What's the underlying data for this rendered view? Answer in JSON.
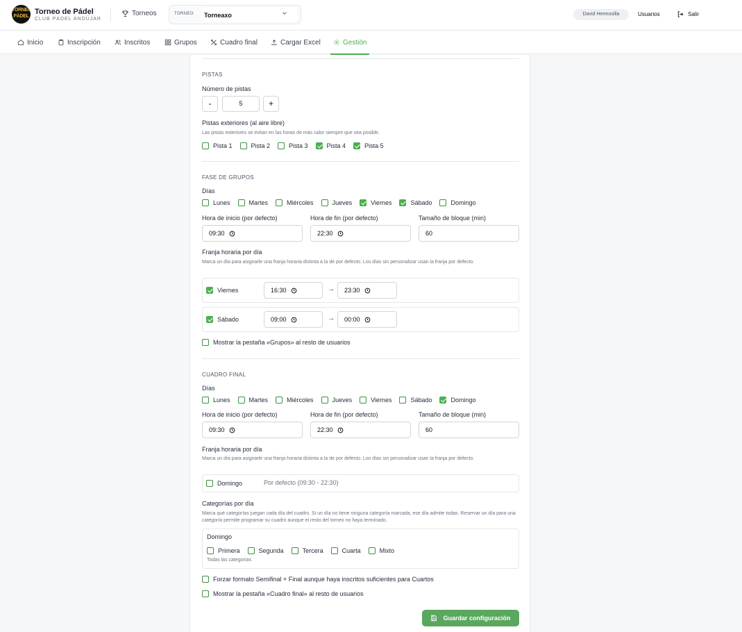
{
  "header": {
    "logo_line1": "TORNEO",
    "logo_line2": "PÁDEL",
    "title": "Torneo de Pádel",
    "subtitle": "CLUB PÁDEL ANDÚJAR",
    "torneos_label": "Torneos",
    "selector_label": "TORNEO",
    "selector_value": "Torneaxo",
    "user": "David Hermosilla",
    "usuarios": "Usuarios",
    "salir": "Salir"
  },
  "tabs": [
    {
      "label": "Inicio",
      "icon": "home-icon"
    },
    {
      "label": "Inscripción",
      "icon": "clipboard-icon"
    },
    {
      "label": "Inscritos",
      "icon": "users-icon"
    },
    {
      "label": "Grupos",
      "icon": "grid-icon"
    },
    {
      "label": "Cuadro final",
      "icon": "bracket-icon"
    },
    {
      "label": "Cargar Excel",
      "icon": "upload-icon"
    },
    {
      "label": "Gestión",
      "icon": "gear-icon",
      "active": true
    }
  ],
  "pistas": {
    "title": "PISTAS",
    "num_label": "Número de pistas",
    "minus": "-",
    "plus": "+",
    "num_value": "5",
    "ext_label": "Pistas exteriores (al aire libre)",
    "ext_help": "Las pistas exteriores se evitan en las horas de más calor siempre que sea posible.",
    "courts": [
      {
        "label": "Pista 1",
        "checked": false
      },
      {
        "label": "Pista 2",
        "checked": false
      },
      {
        "label": "Pista 3",
        "checked": false
      },
      {
        "label": "Pista 4",
        "checked": true
      },
      {
        "label": "Pista 5",
        "checked": true
      }
    ]
  },
  "grupos": {
    "title": "FASE DE GRUPOS",
    "dias_label": "Días",
    "dias": [
      {
        "label": "Lunes",
        "checked": false
      },
      {
        "label": "Martes",
        "checked": false
      },
      {
        "label": "Miércoles",
        "checked": false
      },
      {
        "label": "Jueves",
        "checked": false
      },
      {
        "label": "Viernes",
        "checked": true
      },
      {
        "label": "Sábado",
        "checked": true
      },
      {
        "label": "Domingo",
        "checked": false
      }
    ],
    "inicio_label": "Hora de inicio (por defecto)",
    "inicio": "09:30",
    "fin_label": "Hora de fin (por defecto)",
    "fin": "22:30",
    "bloque_label": "Tamaño de bloque (min)",
    "bloque": "60",
    "franja_label": "Franja horaria por día",
    "franja_help": "Marca un día para asignarle una franja horaria distinta a la de por defecto. Los días sin personalizar usan la franja por defecto.",
    "franjas": [
      {
        "day": "Viernes",
        "checked": true,
        "from": "16:30",
        "to": "23:30"
      },
      {
        "day": "Sábado",
        "checked": true,
        "from": "09:00",
        "to": "00:00"
      }
    ],
    "arrow": "→",
    "mostrar": "Mostrar la pestaña «Grupos» al resto de usuarios"
  },
  "cuadro": {
    "title": "CUADRO FINAL",
    "dias_label": "Días",
    "dias": [
      {
        "label": "Lunes",
        "checked": false
      },
      {
        "label": "Martes",
        "checked": false
      },
      {
        "label": "Miércoles",
        "checked": false
      },
      {
        "label": "Jueves",
        "checked": false
      },
      {
        "label": "Viernes",
        "checked": false
      },
      {
        "label": "Sábado",
        "checked": false
      },
      {
        "label": "Domingo",
        "checked": true
      }
    ],
    "inicio_label": "Hora de inicio (por defecto)",
    "inicio": "09:30",
    "fin_label": "Hora de fin (por defecto)",
    "fin": "22:30",
    "bloque_label": "Tamaño de bloque (min)",
    "bloque": "60",
    "franja_label": "Franja horaria por día",
    "franja_help": "Marca un día para asignarle una franja horaria distinta a la de por defecto. Los días sin personalizar usan la franja por defecto.",
    "franja_day": "Domingo",
    "franja_default": "Por defecto (09:30 - 22:30)",
    "cat_label": "Categorías por día",
    "cat_help": "Marca qué categorías juegan cada día del cuadro. Si un día no tiene ninguna categoría marcada, ese día admite todas. Reservar un día para una categoría permite programar su cuadro aunque el resto del torneo no haya terminado.",
    "cat_day": "Domingo",
    "categorias": [
      {
        "label": "Primera",
        "checked": false
      },
      {
        "label": "Segunda",
        "checked": false
      },
      {
        "label": "Tercera",
        "checked": false
      },
      {
        "label": "Cuarta",
        "checked": false
      },
      {
        "label": "Mixto",
        "checked": false
      }
    ],
    "cat_note": "Todas las categorías",
    "forzar": "Forzar formato Semifinal + Final aunque haya inscritos suficientes para Cuartos",
    "mostrar": "Mostrar la pestaña «Cuadro final» al resto de usuarios"
  },
  "save_label": "Guardar configuración",
  "colors": {
    "accent": "#4caf50",
    "save": "#5aa85e"
  }
}
